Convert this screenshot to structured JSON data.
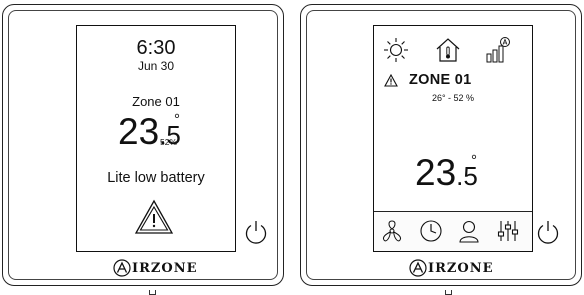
{
  "brand": "IRZONE",
  "left_device": {
    "time": "6:30",
    "date": "Jun 30",
    "zone": "Zone 01",
    "temp_int": "23",
    "temp_dec": ".5",
    "degree": "°",
    "humidity": "52%",
    "message": "Lite low battery",
    "icons": [
      "warning-icon",
      "power-icon"
    ]
  },
  "right_device": {
    "zone": "ZONE 01",
    "subtitle": "26° - 52 %",
    "temp_int": "23",
    "temp_dec": ".5",
    "degree": "°",
    "top_icons": [
      "sun-icon",
      "house-thermometer-icon",
      "signal-bars-icon"
    ],
    "bottom_icons": [
      "fan-icon",
      "clock-icon",
      "user-icon",
      "sliders-icon"
    ],
    "other_icons": [
      "warning-icon",
      "power-icon"
    ]
  }
}
